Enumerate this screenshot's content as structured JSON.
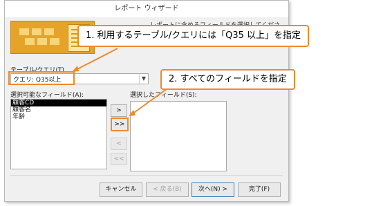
{
  "dialog": {
    "title": "レポート ウィザード",
    "description": "レポートに含めるフィールドを選択してください。"
  },
  "query": {
    "label": "テーブル/クエリ(T)",
    "selected_value": "クエリ: Q35以上"
  },
  "available": {
    "label": "選択可能なフィールド(A):",
    "fields": [
      "顧客CD",
      "顧客名",
      "年齢"
    ],
    "selected_index": 0
  },
  "selected": {
    "label": "選択したフィールド(S):",
    "fields": []
  },
  "move_buttons": {
    "add_one": ">",
    "add_all": ">>",
    "remove_one": "<",
    "remove_all": "<<"
  },
  "footer": {
    "cancel": "キャンセル",
    "back": "< 戻る(B)",
    "next": "次へ(N) >",
    "finish": "完了(F)"
  },
  "callouts": {
    "step1": "1. 利用するテーブル/クエリには「Q35 以上」を指定",
    "step2": "2. すべてのフィールドを指定"
  },
  "colors": {
    "accent": "#ee8a2a",
    "header_image": "#e6a32a"
  }
}
